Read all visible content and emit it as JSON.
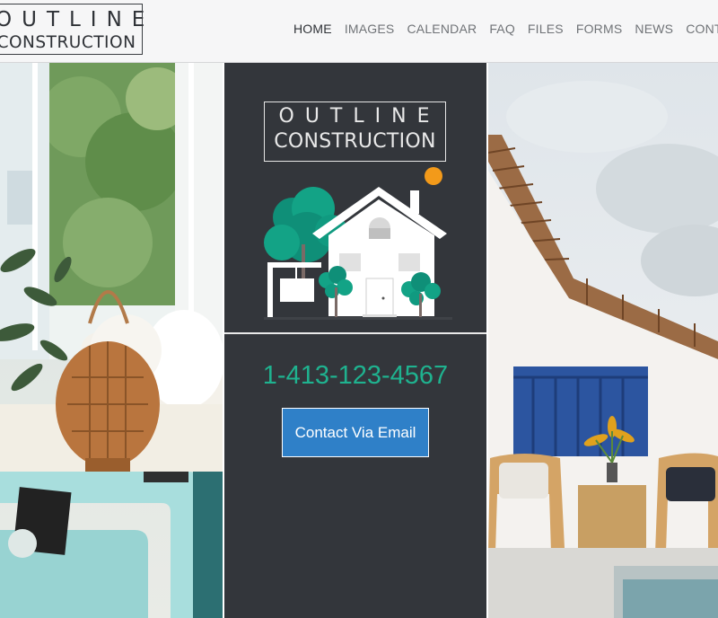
{
  "brand": {
    "logo_line1": "OUTLINE",
    "logo_line2": "CONSTRUCTION"
  },
  "nav": {
    "items": [
      {
        "label": "HOME",
        "active": true
      },
      {
        "label": "IMAGES"
      },
      {
        "label": "CALENDAR"
      },
      {
        "label": "FAQ"
      },
      {
        "label": "FILES"
      },
      {
        "label": "FORMS"
      },
      {
        "label": "NEWS"
      },
      {
        "label": "CONTACT"
      }
    ]
  },
  "hero": {
    "logo_line1": "OUTLINE",
    "logo_line2": "CONSTRUCTION",
    "phone": "1-413-123-4567",
    "cta_label": "Contact Via Email"
  },
  "images": {
    "left": "interior-living-room-photo",
    "right": "patio-house-exterior-photo"
  },
  "colors": {
    "accent_teal": "#1fb28f",
    "button_blue": "#2f80c8",
    "panel_dark": "#33363b",
    "sun_orange": "#f39a1a"
  }
}
